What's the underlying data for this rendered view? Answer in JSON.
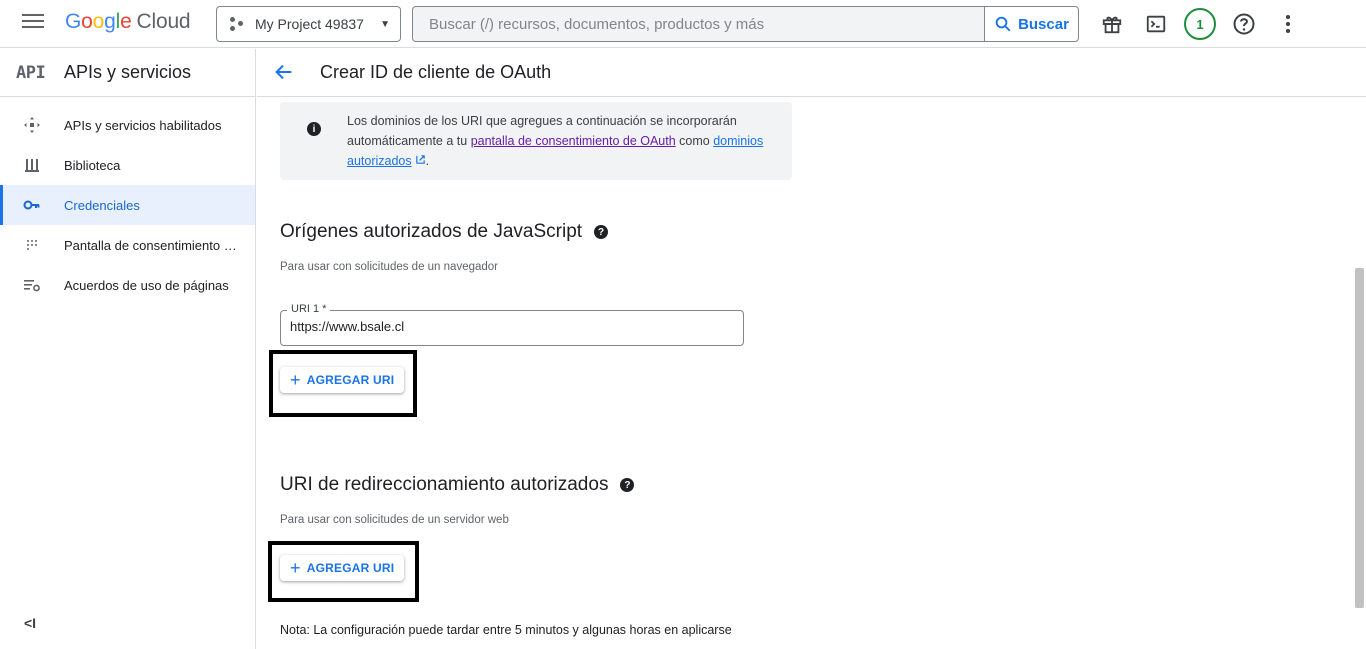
{
  "header": {
    "logo": {
      "g1": "G",
      "g2": "o",
      "g3": "o",
      "g4": "g",
      "g5": "l",
      "g6": "e",
      "cloud": "Cloud"
    },
    "project_name": "My Project 49837",
    "search_placeholder": "Buscar (/) recursos, documentos, productos y más",
    "search_button": "Buscar",
    "notification_count": "1",
    "icons": [
      "menu-icon",
      "gift-icon",
      "terminal-icon",
      "help-icon",
      "more-vert-icon"
    ]
  },
  "sidebar": {
    "logo_text": "API",
    "title": "APIs y servicios",
    "items": [
      {
        "label": "APIs y servicios habilitados",
        "icon": "apis-icon",
        "active": false
      },
      {
        "label": "Biblioteca",
        "icon": "library-icon",
        "active": false
      },
      {
        "label": "Credenciales",
        "icon": "key-icon",
        "active": true
      },
      {
        "label": "Pantalla de consentimiento …",
        "icon": "consent-icon",
        "active": false
      },
      {
        "label": "Acuerdos de uso de páginas",
        "icon": "settings-list-icon",
        "active": false
      }
    ],
    "collapse": "<I"
  },
  "page": {
    "title": "Crear ID de cliente de OAuth",
    "info": {
      "text1": "Los dominios de los URI que agregues a continuación se incorporarán automáticamente a tu ",
      "link1": "pantalla de consentimiento de OAuth",
      "text2": " como ",
      "link2": "dominios autorizados",
      "text3": "."
    },
    "js_origins": {
      "title": "Orígenes autorizados de JavaScript",
      "subtitle": "Para usar con solicitudes de un navegador",
      "uri_label": "URI 1 *",
      "uri_value": "https://www.bsale.cl",
      "add_button": "AGREGAR URI"
    },
    "redirect_uris": {
      "title": "URI de redireccionamiento autorizados",
      "subtitle": "Para usar con solicitudes de un servidor web",
      "add_button": "AGREGAR URI"
    },
    "note": "Nota: La configuración puede tardar entre 5 minutos y algunas horas en aplicarse"
  },
  "colors": {
    "accent": "#1a73e8",
    "active_bg": "#e8f0fe",
    "badge": "#1e8e3e",
    "link_visited": "#681da8"
  }
}
